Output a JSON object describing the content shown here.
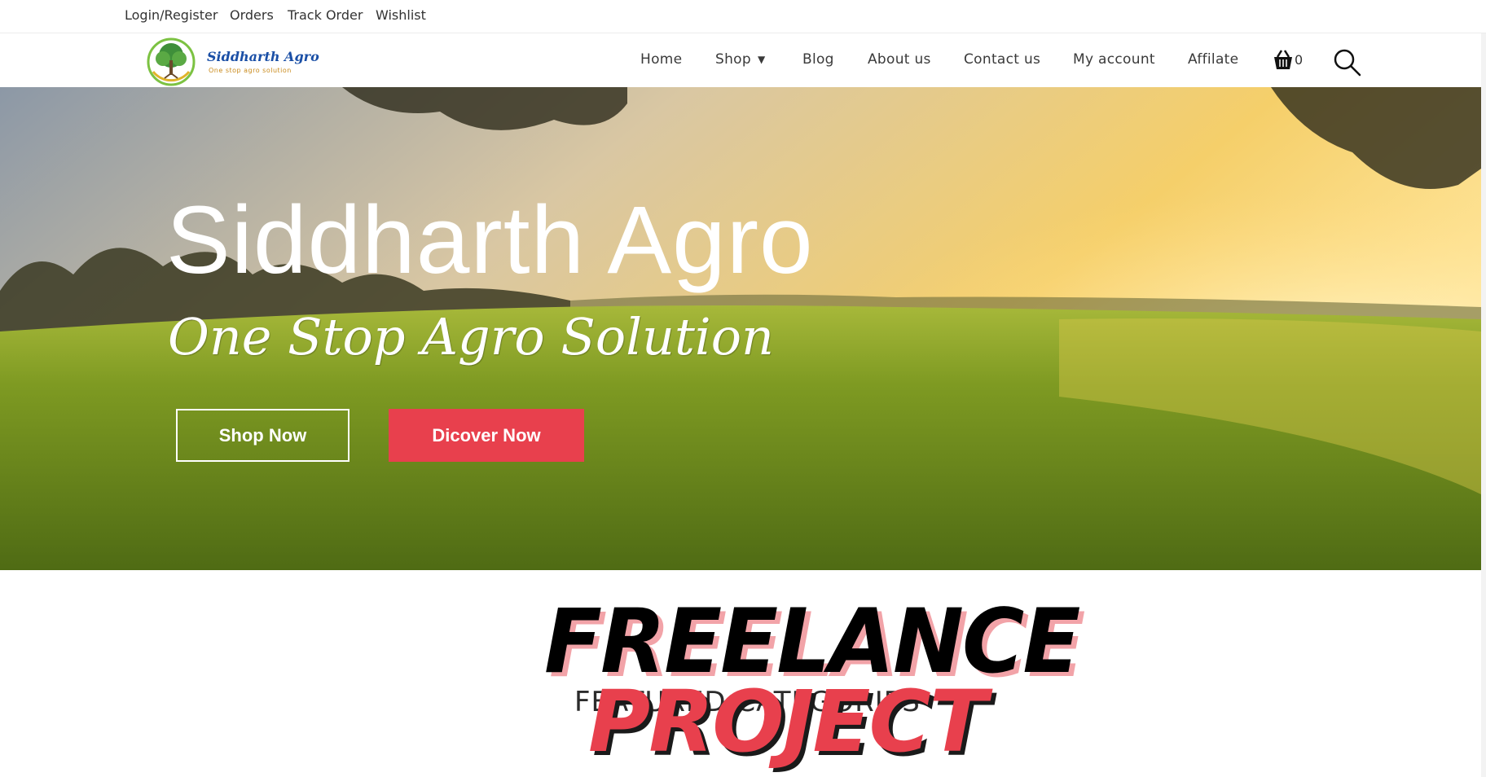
{
  "topbar": {
    "links": [
      "Login/Register",
      "Orders",
      "Track Order",
      "Wishlist"
    ]
  },
  "logo": {
    "title": "Siddharth Agro",
    "tagline": "One stop agro solution"
  },
  "nav": {
    "items": [
      "Home",
      "Shop",
      "Blog",
      "About us",
      "Contact us",
      "My account",
      "Affilate"
    ],
    "cart_count": "0"
  },
  "hero": {
    "title": "Siddharth Agro",
    "subtitle": "One Stop Agro Solution",
    "shop_button": "Shop Now",
    "discover_button": "Dicover Now"
  },
  "section": {
    "heading": "FEATURED CATEGORIES"
  },
  "watermark": {
    "line1": "FREELANCE",
    "line2": "PROJECT"
  },
  "colors": {
    "accent": "#e8404d",
    "text": "#333333",
    "brand_blue": "#1a4fa6"
  }
}
